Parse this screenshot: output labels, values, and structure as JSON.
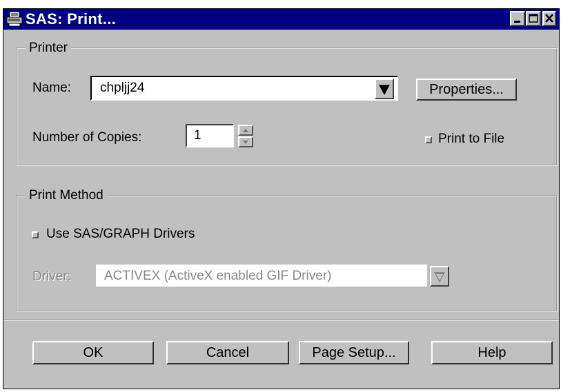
{
  "window": {
    "title": "SAS: Print...",
    "title_icon": "printer-icon",
    "controls": [
      "minimize-icon",
      "maximize-icon",
      "close-icon"
    ],
    "title_bar_color": "#000080",
    "face_color": "#c0c0c0"
  },
  "printer_group": {
    "legend": "Printer",
    "name_label": "Name:",
    "name_value": "chpljj24",
    "properties_button": "Properties...",
    "copies_label": "Number of Copies:",
    "copies_value": "1",
    "print_to_file_label": "Print to File"
  },
  "method_group": {
    "legend": "Print Method",
    "use_drivers_label": "Use SAS/GRAPH Drivers",
    "driver_label": "Driver:",
    "driver_value": "ACTIVEX (ActiveX enabled GIF Driver)"
  },
  "buttons": {
    "ok": "OK",
    "cancel": "Cancel",
    "page_setup": "Page Setup...",
    "help": "Help"
  }
}
